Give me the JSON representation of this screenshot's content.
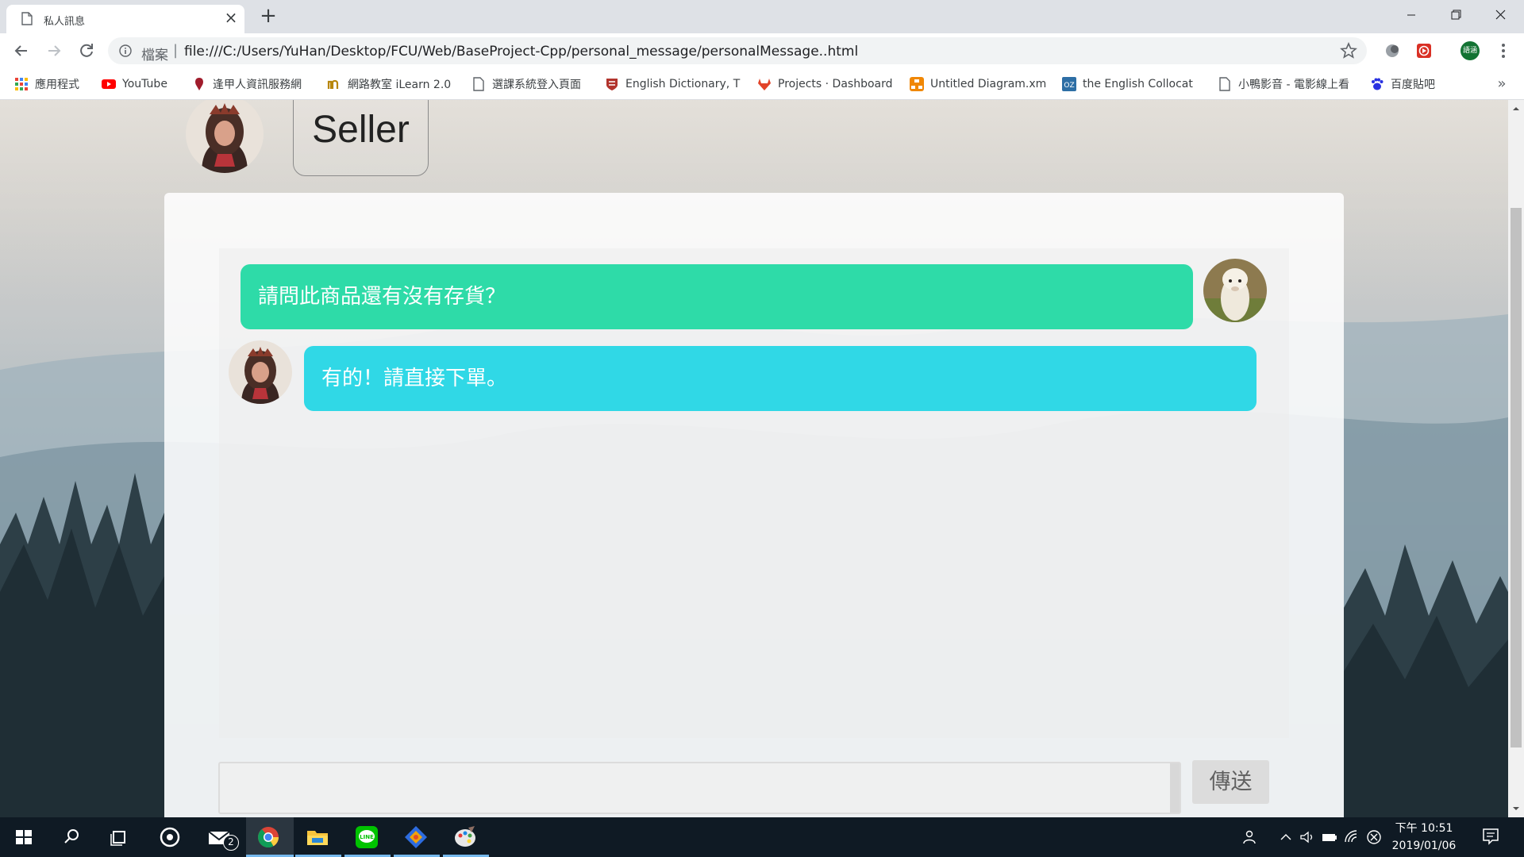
{
  "browser": {
    "tab_title": "私人訊息",
    "address_scheme": "檔案",
    "address_url": "file:///C:/Users/YuHan/Desktop/FCU/Web/BaseProject-Cpp/personal_message/personalMessage..html",
    "profile_label": "語涵"
  },
  "bookmarks": [
    {
      "label": "應用程式",
      "icon": "apps-grid-icon"
    },
    {
      "label": "YouTube",
      "icon": "youtube-icon"
    },
    {
      "label": "逢甲人資訊服務網",
      "icon": "fcu-icon"
    },
    {
      "label": "網路教室 iLearn 2.0",
      "icon": "ilearn-icon"
    },
    {
      "label": "選課系統登入頁面",
      "icon": "page-icon"
    },
    {
      "label": "English Dictionary, T",
      "icon": "cambridge-icon"
    },
    {
      "label": "Projects · Dashboard",
      "icon": "gitlab-icon"
    },
    {
      "label": "Untitled Diagram.xm",
      "icon": "drawio-icon"
    },
    {
      "label": "the English Collocat",
      "icon": "oz-icon"
    },
    {
      "label": "小鴨影音 - 電影線上看",
      "icon": "page-icon"
    },
    {
      "label": "百度貼吧",
      "icon": "baidu-icon"
    }
  ],
  "header": {
    "seller_label": "Seller"
  },
  "chat": {
    "messages": [
      {
        "sender": "buyer",
        "text": "請問此商品還有沒有存貨？"
      },
      {
        "sender": "seller",
        "text": "有的！請直接下單。"
      }
    ],
    "input_value": "",
    "send_label": "傳送"
  },
  "taskbar": {
    "mail_badge": "2",
    "clock_time": "下午 10:51",
    "clock_date": "2019/01/06"
  },
  "colors": {
    "buyer_bubble": "#2edba8",
    "seller_bubble": "#30d8e6",
    "send_button": "#dcdcdc"
  }
}
